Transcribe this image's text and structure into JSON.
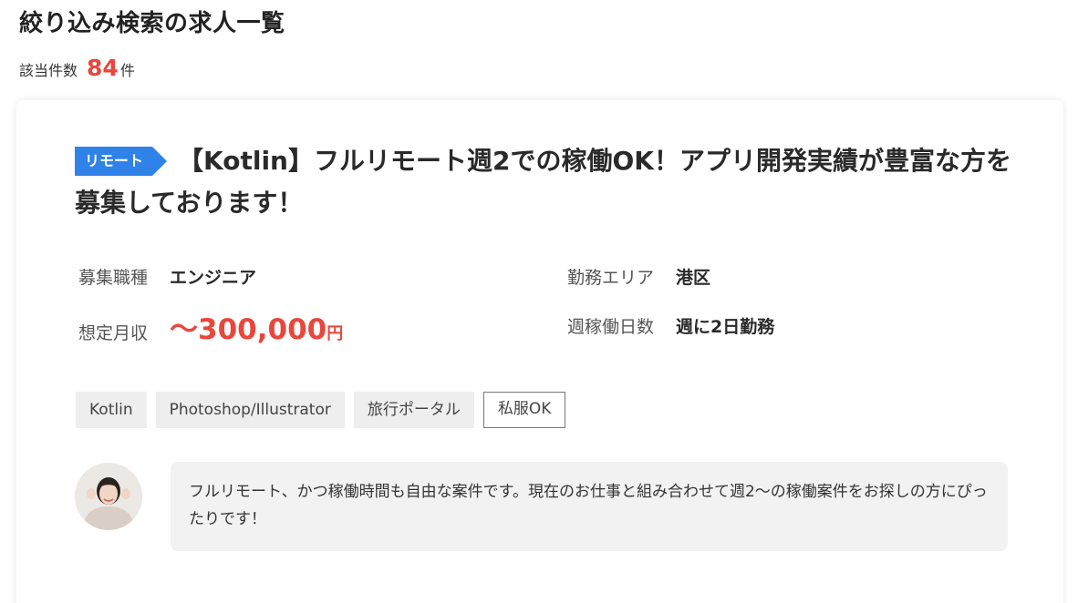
{
  "page": {
    "title": "絞り込み検索の求人一覧",
    "count_label": "該当件数",
    "count_value": "84",
    "count_unit": "件"
  },
  "job": {
    "badge": "リモート",
    "title": "【Kotlin】フルリモート週2での稼働OK！アプリ開発実績が豊富な方を募集しております！",
    "job_type_label": "募集職種",
    "job_type_value": "エンジニア",
    "area_label": "勤務エリア",
    "area_value": "港区",
    "salary_label": "想定月収",
    "salary_value": "〜300,000",
    "salary_unit": "円",
    "days_label": "週稼働日数",
    "days_value": "週に2日勤務",
    "tags": [
      "Kotlin",
      "Photoshop/Illustrator",
      "旅行ポータル",
      "私服OK"
    ],
    "comment": "フルリモート、かつ稼働時間も自由な案件です。現在のお仕事と組み合わせて週2〜の稼働案件をお探しの方にぴったりです！"
  },
  "colors": {
    "accent_red": "#e8473d",
    "badge_blue": "#2f82e8"
  }
}
